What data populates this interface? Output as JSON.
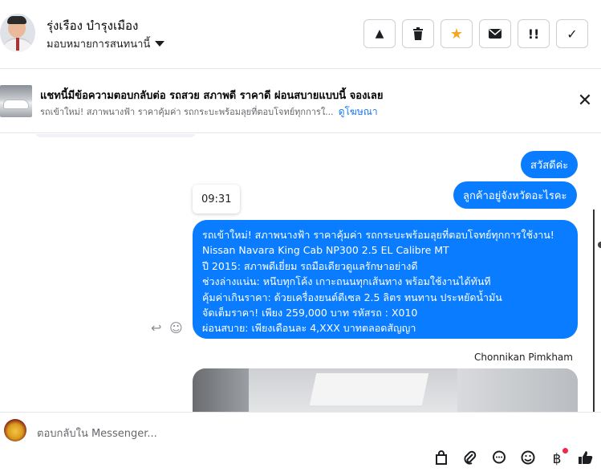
{
  "header": {
    "contact_name": "รุ่งเรือง บำรุงเมือง",
    "assign_label": "มอบหมายการสนทนานี้",
    "buttons": [
      {
        "name": "spam-button",
        "icon": "warning-icon",
        "glyph": "▲"
      },
      {
        "name": "delete-button",
        "icon": "trash-icon",
        "glyph": "🗑"
      },
      {
        "name": "star-button",
        "icon": "star-icon",
        "glyph": "★",
        "color": "#f5a623"
      },
      {
        "name": "mark-unread-button",
        "icon": "envelope-icon",
        "glyph": "✉"
      },
      {
        "name": "follow-up-button",
        "icon": "double-exclamation-icon",
        "glyph": "!!"
      },
      {
        "name": "mark-done-button",
        "icon": "checkmark-icon",
        "glyph": "✓"
      }
    ]
  },
  "ad": {
    "title": "แชทนี้มีข้อความตอบกลับต่อ รถสวย สภาพดี ราคาดี ผ่อนสบายแบบนี้ จองเลย",
    "subtitle": "รถเข้าใหม่! สภาพนางฟ้า ราคาคุ้มค่า รถกระบะพร้อมลุยที่ตอบโจทย์ทุกการใ...",
    "link_label": "ดูโฆษณา",
    "close_glyph": "✕"
  },
  "chat": {
    "msg1": "สวัสดีค่ะ",
    "msg2": "ลูกค้าอยู่จังหวัดอะไรคะ",
    "timestamp": "09:31",
    "long_message": [
      "รถเข้าใหม่! สภาพนางฟ้า ราคาคุ้มค่า รถกระบะพร้อมลุยที่ตอบโจทย์ทุกการใช้งาน!",
      "Nissan Navara King Cab NP300 2.5 EL Calibre MT",
      "ปี 2015: สภาพดีเยี่ยม รถมือเดียวดูแลรักษาอย่างดี",
      "ช่วงล่างแน่น: หนึบทุกโค้ง เกาะถนนทุกเส้นทาง พร้อมใช้งานได้ทันที",
      "คุ้มค่าเกินราคา: ด้วยเครื่องยนต์ดีเซล 2.5 ลิตร ทนทาน ประหยัดน้ำมัน",
      "จัดเต็มราคา! เพียง 259,000 บาท  รหัสรถ : X010",
      "ผ่อนสบาย: เพียงเดือนละ 4,XXX บาทตลอดสัญญา"
    ],
    "sender_name": "Chonnikan Pimkham"
  },
  "composer": {
    "placeholder": "ตอบกลับใน Messenger...",
    "tools": [
      {
        "name": "bag-icon",
        "glyph": "👜"
      },
      {
        "name": "attachment-icon",
        "glyph": "📎"
      },
      {
        "name": "chat-bubble-icon",
        "glyph": "💬"
      },
      {
        "name": "emoji-icon",
        "glyph": "☺"
      },
      {
        "name": "baht-icon",
        "glyph": "฿"
      },
      {
        "name": "thumbs-up-icon",
        "glyph": "👍"
      }
    ]
  },
  "colors": {
    "accent": "#0a7cff",
    "link": "#1877f2",
    "star": "#f5a623",
    "notification": "#f02849"
  }
}
